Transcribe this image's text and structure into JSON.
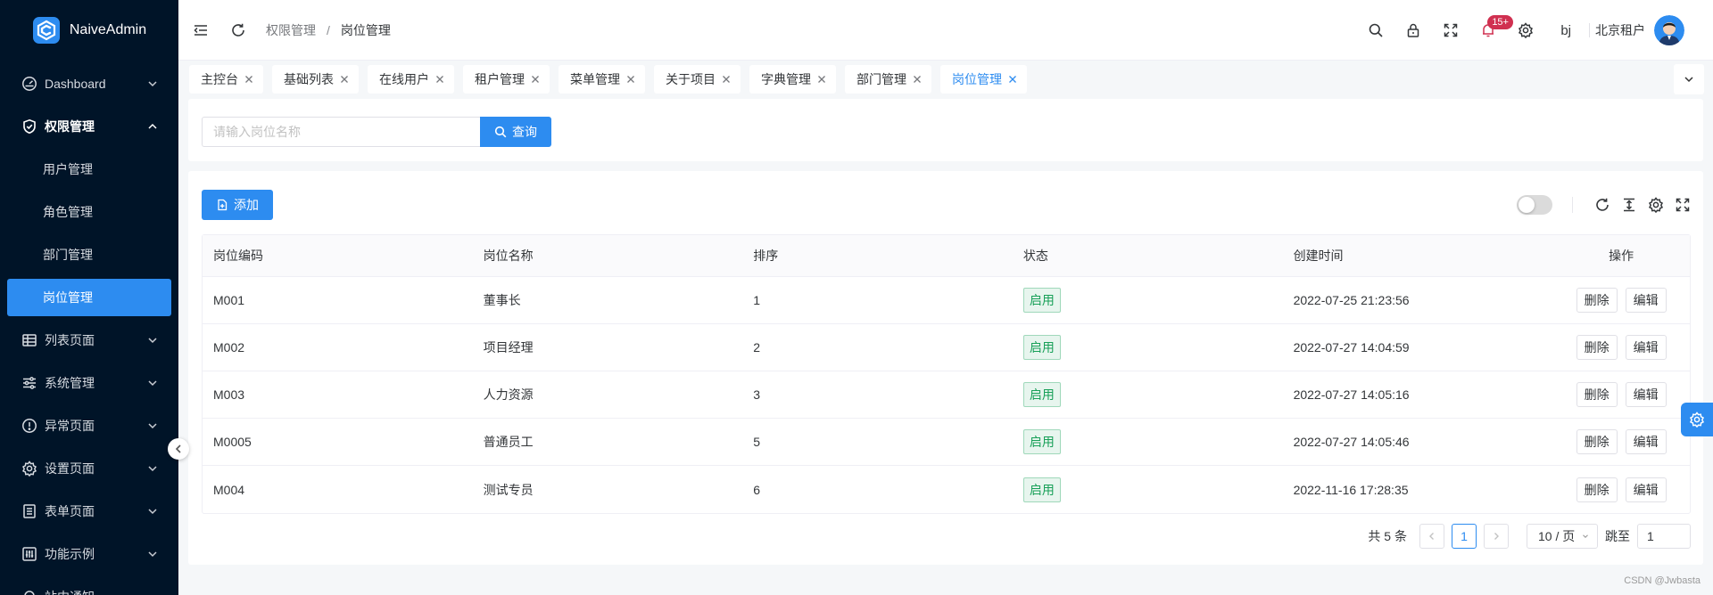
{
  "app": {
    "name": "NaiveAdmin"
  },
  "sidebar": {
    "items": [
      {
        "label": "Dashboard",
        "icon": "dashboard-icon",
        "expanded": false
      },
      {
        "label": "权限管理",
        "icon": "shield-icon",
        "expanded": true,
        "children": [
          "用户管理",
          "角色管理",
          "部门管理",
          "岗位管理"
        ],
        "active_child": "岗位管理"
      },
      {
        "label": "列表页面",
        "icon": "table-icon",
        "expanded": false
      },
      {
        "label": "系统管理",
        "icon": "sliders-icon",
        "expanded": false
      },
      {
        "label": "异常页面",
        "icon": "alert-icon",
        "expanded": false
      },
      {
        "label": "设置页面",
        "icon": "gear-icon",
        "expanded": false
      },
      {
        "label": "表单页面",
        "icon": "form-icon",
        "expanded": false
      },
      {
        "label": "功能示例",
        "icon": "function-icon",
        "expanded": false
      },
      {
        "label": "站内通知",
        "icon": "bell-icon",
        "expanded": false
      }
    ]
  },
  "header": {
    "breadcrumb": [
      "权限管理",
      "岗位管理"
    ],
    "separator": "/",
    "notification_badge": "15+",
    "user_code": "bj",
    "tenant": "北京租户"
  },
  "tabs": [
    {
      "label": "主控台"
    },
    {
      "label": "基础列表"
    },
    {
      "label": "在线用户"
    },
    {
      "label": "租户管理"
    },
    {
      "label": "菜单管理"
    },
    {
      "label": "关于项目"
    },
    {
      "label": "字典管理"
    },
    {
      "label": "部门管理"
    },
    {
      "label": "岗位管理",
      "active": true
    }
  ],
  "search": {
    "placeholder": "请输入岗位名称",
    "value": "",
    "button_label": "查询"
  },
  "toolbar": {
    "add_label": "添加"
  },
  "table": {
    "headers": [
      "岗位编码",
      "岗位名称",
      "排序",
      "状态",
      "创建时间",
      "操作"
    ],
    "rows": [
      {
        "code": "M001",
        "name": "董事长",
        "sort": "1",
        "status": "启用",
        "created": "2022-07-25 21:23:56",
        "delete": "删除",
        "edit": "编辑"
      },
      {
        "code": "M002",
        "name": "项目经理",
        "sort": "2",
        "status": "启用",
        "created": "2022-07-27 14:04:59",
        "delete": "删除",
        "edit": "编辑"
      },
      {
        "code": "M003",
        "name": "人力资源",
        "sort": "3",
        "status": "启用",
        "created": "2022-07-27 14:05:16",
        "delete": "删除",
        "edit": "编辑"
      },
      {
        "code": "M0005",
        "name": "普通员工",
        "sort": "5",
        "status": "启用",
        "created": "2022-07-27 14:05:46",
        "delete": "删除",
        "edit": "编辑"
      },
      {
        "code": "M004",
        "name": "测试专员",
        "sort": "6",
        "status": "启用",
        "created": "2022-11-16 17:28:35",
        "delete": "删除",
        "edit": "编辑"
      }
    ]
  },
  "pagination": {
    "total_text": "共 5 条",
    "current_page": "1",
    "page_size": "10 / 页",
    "jump_label": "跳至",
    "jump_value": "1"
  },
  "watermark": "CSDN @Jwbasta",
  "colors": {
    "primary": "#2d8cf0",
    "sidebar_bg": "#001428",
    "success": "#18a058",
    "badge": "#d03050"
  }
}
